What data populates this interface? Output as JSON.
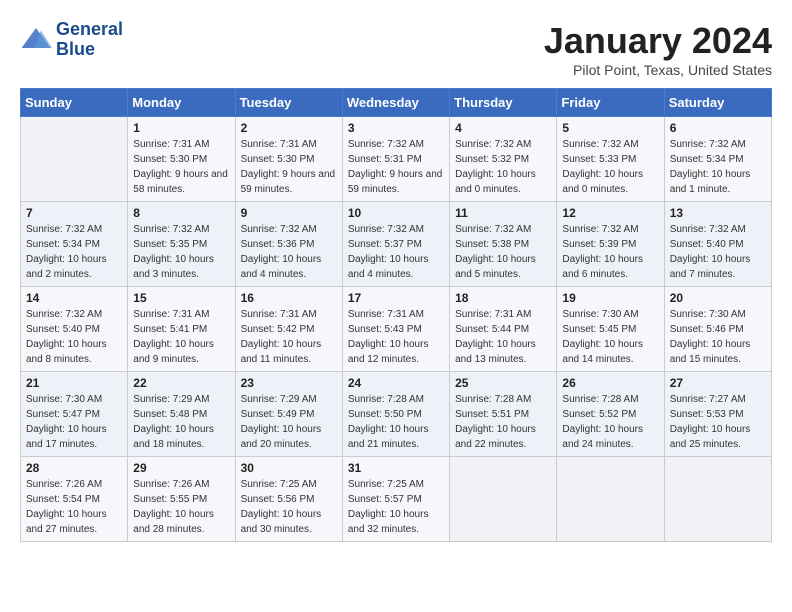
{
  "logo": {
    "line1": "General",
    "line2": "Blue"
  },
  "title": "January 2024",
  "location": "Pilot Point, Texas, United States",
  "days_of_week": [
    "Sunday",
    "Monday",
    "Tuesday",
    "Wednesday",
    "Thursday",
    "Friday",
    "Saturday"
  ],
  "weeks": [
    [
      {
        "num": "",
        "sunrise": "",
        "sunset": "",
        "daylight": ""
      },
      {
        "num": "1",
        "sunrise": "Sunrise: 7:31 AM",
        "sunset": "Sunset: 5:30 PM",
        "daylight": "Daylight: 9 hours and 58 minutes."
      },
      {
        "num": "2",
        "sunrise": "Sunrise: 7:31 AM",
        "sunset": "Sunset: 5:30 PM",
        "daylight": "Daylight: 9 hours and 59 minutes."
      },
      {
        "num": "3",
        "sunrise": "Sunrise: 7:32 AM",
        "sunset": "Sunset: 5:31 PM",
        "daylight": "Daylight: 9 hours and 59 minutes."
      },
      {
        "num": "4",
        "sunrise": "Sunrise: 7:32 AM",
        "sunset": "Sunset: 5:32 PM",
        "daylight": "Daylight: 10 hours and 0 minutes."
      },
      {
        "num": "5",
        "sunrise": "Sunrise: 7:32 AM",
        "sunset": "Sunset: 5:33 PM",
        "daylight": "Daylight: 10 hours and 0 minutes."
      },
      {
        "num": "6",
        "sunrise": "Sunrise: 7:32 AM",
        "sunset": "Sunset: 5:34 PM",
        "daylight": "Daylight: 10 hours and 1 minute."
      }
    ],
    [
      {
        "num": "7",
        "sunrise": "Sunrise: 7:32 AM",
        "sunset": "Sunset: 5:34 PM",
        "daylight": "Daylight: 10 hours and 2 minutes."
      },
      {
        "num": "8",
        "sunrise": "Sunrise: 7:32 AM",
        "sunset": "Sunset: 5:35 PM",
        "daylight": "Daylight: 10 hours and 3 minutes."
      },
      {
        "num": "9",
        "sunrise": "Sunrise: 7:32 AM",
        "sunset": "Sunset: 5:36 PM",
        "daylight": "Daylight: 10 hours and 4 minutes."
      },
      {
        "num": "10",
        "sunrise": "Sunrise: 7:32 AM",
        "sunset": "Sunset: 5:37 PM",
        "daylight": "Daylight: 10 hours and 4 minutes."
      },
      {
        "num": "11",
        "sunrise": "Sunrise: 7:32 AM",
        "sunset": "Sunset: 5:38 PM",
        "daylight": "Daylight: 10 hours and 5 minutes."
      },
      {
        "num": "12",
        "sunrise": "Sunrise: 7:32 AM",
        "sunset": "Sunset: 5:39 PM",
        "daylight": "Daylight: 10 hours and 6 minutes."
      },
      {
        "num": "13",
        "sunrise": "Sunrise: 7:32 AM",
        "sunset": "Sunset: 5:40 PM",
        "daylight": "Daylight: 10 hours and 7 minutes."
      }
    ],
    [
      {
        "num": "14",
        "sunrise": "Sunrise: 7:32 AM",
        "sunset": "Sunset: 5:40 PM",
        "daylight": "Daylight: 10 hours and 8 minutes."
      },
      {
        "num": "15",
        "sunrise": "Sunrise: 7:31 AM",
        "sunset": "Sunset: 5:41 PM",
        "daylight": "Daylight: 10 hours and 9 minutes."
      },
      {
        "num": "16",
        "sunrise": "Sunrise: 7:31 AM",
        "sunset": "Sunset: 5:42 PM",
        "daylight": "Daylight: 10 hours and 11 minutes."
      },
      {
        "num": "17",
        "sunrise": "Sunrise: 7:31 AM",
        "sunset": "Sunset: 5:43 PM",
        "daylight": "Daylight: 10 hours and 12 minutes."
      },
      {
        "num": "18",
        "sunrise": "Sunrise: 7:31 AM",
        "sunset": "Sunset: 5:44 PM",
        "daylight": "Daylight: 10 hours and 13 minutes."
      },
      {
        "num": "19",
        "sunrise": "Sunrise: 7:30 AM",
        "sunset": "Sunset: 5:45 PM",
        "daylight": "Daylight: 10 hours and 14 minutes."
      },
      {
        "num": "20",
        "sunrise": "Sunrise: 7:30 AM",
        "sunset": "Sunset: 5:46 PM",
        "daylight": "Daylight: 10 hours and 15 minutes."
      }
    ],
    [
      {
        "num": "21",
        "sunrise": "Sunrise: 7:30 AM",
        "sunset": "Sunset: 5:47 PM",
        "daylight": "Daylight: 10 hours and 17 minutes."
      },
      {
        "num": "22",
        "sunrise": "Sunrise: 7:29 AM",
        "sunset": "Sunset: 5:48 PM",
        "daylight": "Daylight: 10 hours and 18 minutes."
      },
      {
        "num": "23",
        "sunrise": "Sunrise: 7:29 AM",
        "sunset": "Sunset: 5:49 PM",
        "daylight": "Daylight: 10 hours and 20 minutes."
      },
      {
        "num": "24",
        "sunrise": "Sunrise: 7:28 AM",
        "sunset": "Sunset: 5:50 PM",
        "daylight": "Daylight: 10 hours and 21 minutes."
      },
      {
        "num": "25",
        "sunrise": "Sunrise: 7:28 AM",
        "sunset": "Sunset: 5:51 PM",
        "daylight": "Daylight: 10 hours and 22 minutes."
      },
      {
        "num": "26",
        "sunrise": "Sunrise: 7:28 AM",
        "sunset": "Sunset: 5:52 PM",
        "daylight": "Daylight: 10 hours and 24 minutes."
      },
      {
        "num": "27",
        "sunrise": "Sunrise: 7:27 AM",
        "sunset": "Sunset: 5:53 PM",
        "daylight": "Daylight: 10 hours and 25 minutes."
      }
    ],
    [
      {
        "num": "28",
        "sunrise": "Sunrise: 7:26 AM",
        "sunset": "Sunset: 5:54 PM",
        "daylight": "Daylight: 10 hours and 27 minutes."
      },
      {
        "num": "29",
        "sunrise": "Sunrise: 7:26 AM",
        "sunset": "Sunset: 5:55 PM",
        "daylight": "Daylight: 10 hours and 28 minutes."
      },
      {
        "num": "30",
        "sunrise": "Sunrise: 7:25 AM",
        "sunset": "Sunset: 5:56 PM",
        "daylight": "Daylight: 10 hours and 30 minutes."
      },
      {
        "num": "31",
        "sunrise": "Sunrise: 7:25 AM",
        "sunset": "Sunset: 5:57 PM",
        "daylight": "Daylight: 10 hours and 32 minutes."
      },
      {
        "num": "",
        "sunrise": "",
        "sunset": "",
        "daylight": ""
      },
      {
        "num": "",
        "sunrise": "",
        "sunset": "",
        "daylight": ""
      },
      {
        "num": "",
        "sunrise": "",
        "sunset": "",
        "daylight": ""
      }
    ]
  ]
}
